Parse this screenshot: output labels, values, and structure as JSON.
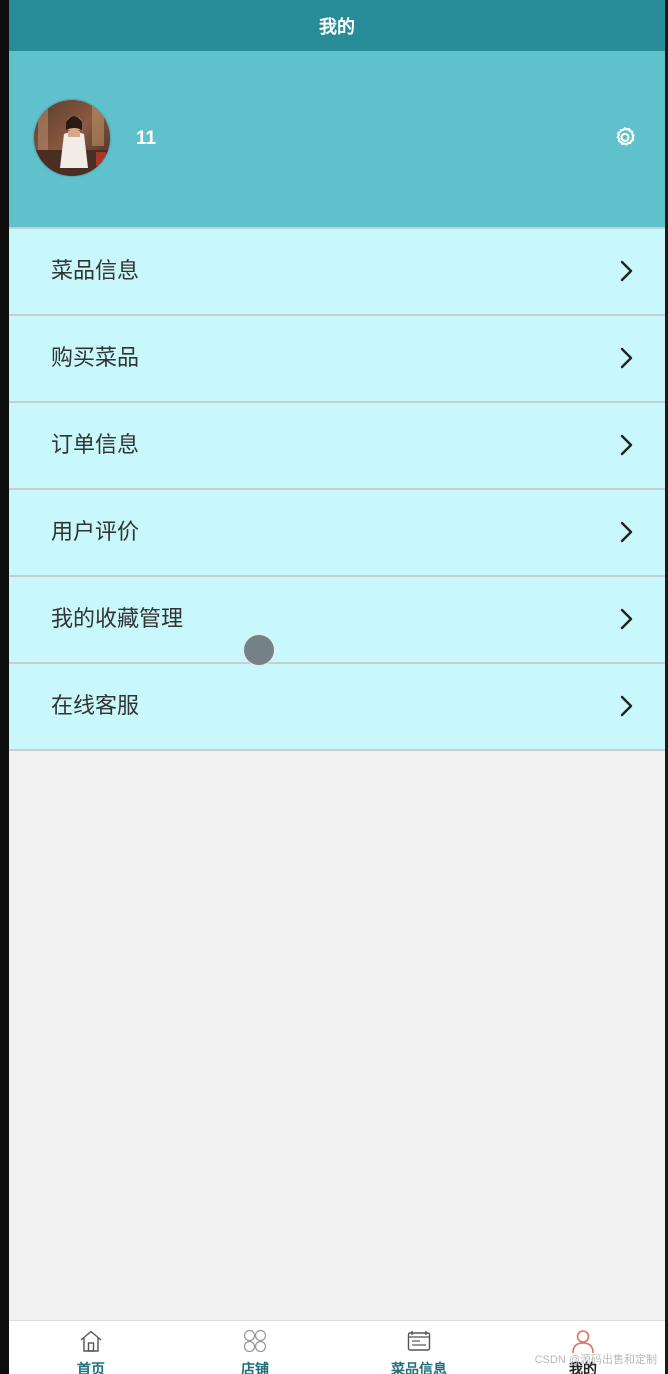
{
  "header": {
    "title": "我的"
  },
  "profile": {
    "username": "11",
    "avatar_icon": "avatar-photo",
    "settings_icon": "gear-icon"
  },
  "menu": {
    "items": [
      {
        "label": "菜品信息",
        "icon": "chevron-right-icon"
      },
      {
        "label": "购买菜品",
        "icon": "chevron-right-icon"
      },
      {
        "label": "订单信息",
        "icon": "chevron-right-icon"
      },
      {
        "label": "用户评价",
        "icon": "chevron-right-icon"
      },
      {
        "label": "我的收藏管理",
        "icon": "chevron-right-icon"
      },
      {
        "label": "在线客服",
        "icon": "chevron-right-icon"
      }
    ]
  },
  "tabbar": {
    "tabs": [
      {
        "label": "首页",
        "icon": "home-icon"
      },
      {
        "label": "店铺",
        "icon": "grid-icon"
      },
      {
        "label": "菜品信息",
        "icon": "list-icon"
      },
      {
        "label": "我的",
        "icon": "user-icon",
        "active": true
      }
    ]
  },
  "watermark": "CSDN @源码出售和定制",
  "colors": {
    "header_bg": "#278c98",
    "profile_bg": "#5fc1cc",
    "menu_bg": "#c8f8fb",
    "page_bg": "#f1f1f1",
    "tab_active_icon": "#e0715e",
    "tab_label": "#1e6f7b"
  }
}
